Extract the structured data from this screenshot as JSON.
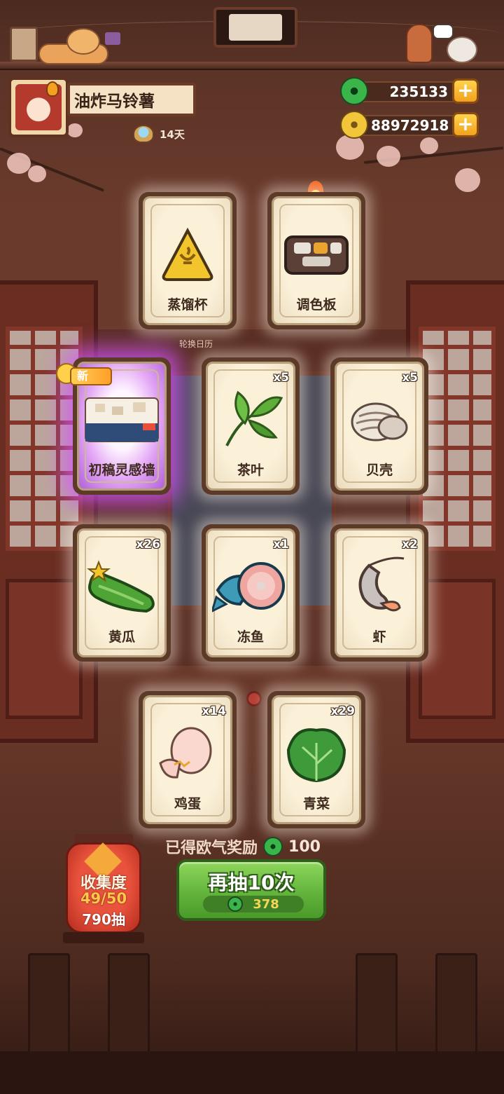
{
  "player": {
    "name": "油炸马铃薯",
    "days": "14天"
  },
  "currencies": {
    "jade": {
      "value": "235133",
      "icon": "jade-coin-icon"
    },
    "gold": {
      "value": "88972918",
      "icon": "gold-coin-icon"
    },
    "plus_label": "+"
  },
  "background": {
    "calendar_label": "轮换日历"
  },
  "cards": [
    {
      "label": "蒸馏杯",
      "count": "",
      "icon": "distill-cup-icon"
    },
    {
      "label": "调色板",
      "count": "",
      "icon": "palette-icon"
    },
    {
      "label": "初稿灵感墙",
      "count": "",
      "icon": "inspiration-wall-icon",
      "badge": "新"
    },
    {
      "label": "茶叶",
      "count": "x5",
      "icon": "tea-leaf-icon"
    },
    {
      "label": "贝壳",
      "count": "x5",
      "icon": "shell-icon"
    },
    {
      "label": "黄瓜",
      "count": "x26",
      "icon": "cucumber-icon"
    },
    {
      "label": "冻鱼",
      "count": "x1",
      "icon": "frozen-fish-icon"
    },
    {
      "label": "虾",
      "count": "x2",
      "icon": "shrimp-icon"
    },
    {
      "label": "鸡蛋",
      "count": "x14",
      "icon": "egg-icon"
    },
    {
      "label": "青菜",
      "count": "x29",
      "icon": "greens-icon"
    }
  ],
  "reward": {
    "label": "已得欧气奖励",
    "amount": "100"
  },
  "draw_button": {
    "label": "再抽10次",
    "cost": "378"
  },
  "collection": {
    "title": "收集度",
    "progress": "49/50",
    "draws": "790抽"
  },
  "colors": {
    "draw_button": "#5fb13a",
    "new_glow": "#d454ff",
    "lantern": "#b42b1d",
    "plus_button": "#f1a21f"
  }
}
